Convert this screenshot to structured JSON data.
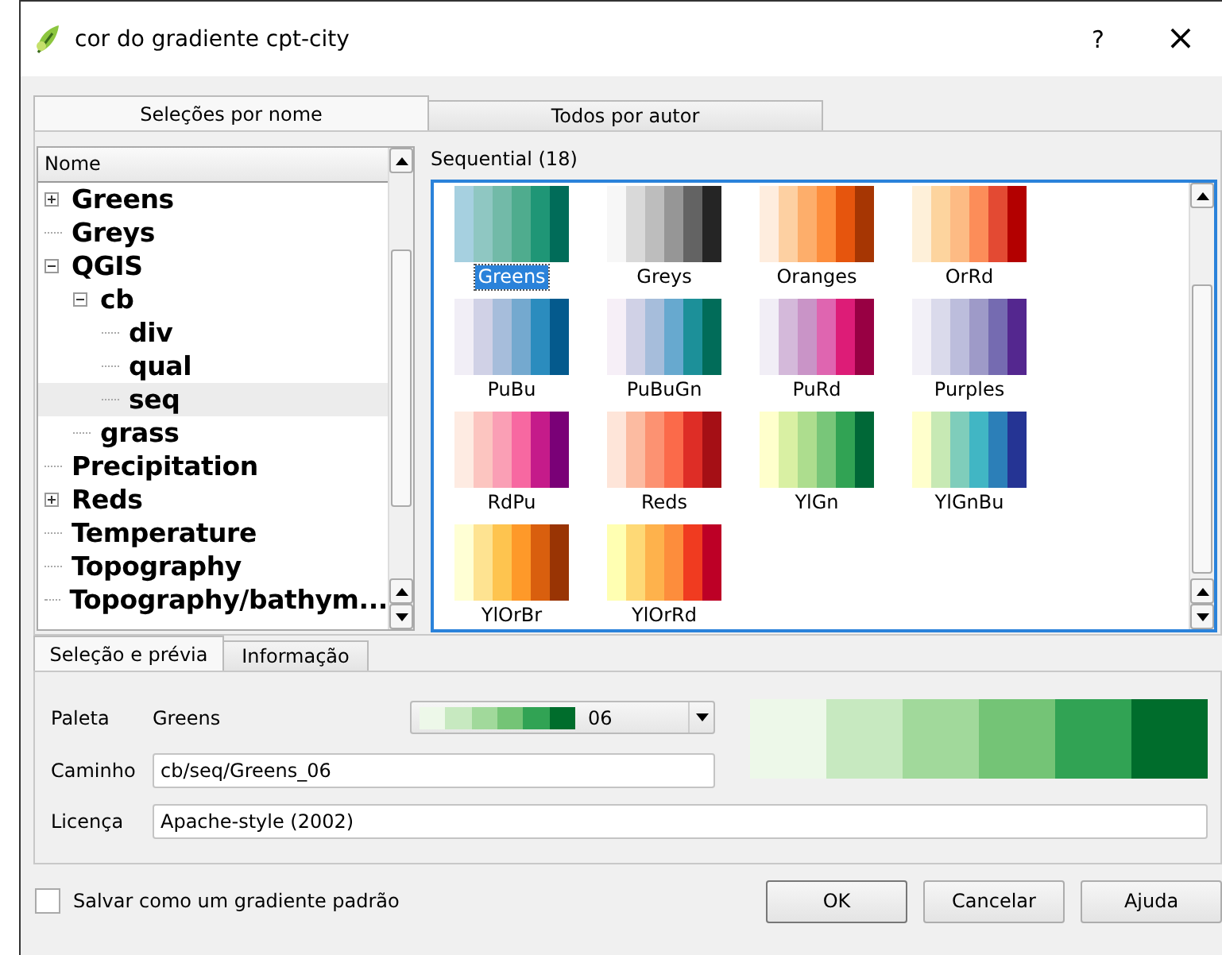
{
  "window": {
    "title": "cor do gradiente cpt-city",
    "help": "?",
    "close": "×"
  },
  "tabs": [
    {
      "label": "Seleções por nome",
      "selected": true
    },
    {
      "label": "Todos por autor",
      "selected": false
    }
  ],
  "tree": {
    "header": "Nome",
    "items": [
      {
        "label": "Greens",
        "expanded": false,
        "selected": false
      },
      {
        "label": "Greys",
        "selected": false
      },
      {
        "label": "QGIS",
        "expanded": true,
        "selected": false,
        "children": [
          {
            "label": "cb",
            "expanded": true,
            "selected": false,
            "children": [
              {
                "label": "div",
                "selected": false
              },
              {
                "label": "qual",
                "selected": false
              },
              {
                "label": "seq",
                "selected": true
              }
            ]
          },
          {
            "label": "grass",
            "selected": false
          }
        ]
      },
      {
        "label": "Precipitation",
        "selected": false
      },
      {
        "label": "Reds",
        "expanded": false,
        "selected": false
      },
      {
        "label": "Temperature",
        "selected": false
      },
      {
        "label": "Topography",
        "selected": false
      },
      {
        "label": "Topography/bathym...",
        "selected": false
      }
    ]
  },
  "gallery": {
    "title": "Sequential (18)",
    "palettes": [
      {
        "name": "Greens",
        "selected": true,
        "colors": [
          {
            "color": "#a6d0e0"
          },
          {
            "color": "#8fc7c2"
          },
          {
            "color": "#72baa8"
          },
          {
            "color": "#4fac8e"
          },
          {
            "color": "#1f9676"
          },
          {
            "color": "#016c59"
          }
        ]
      },
      {
        "name": "Greys",
        "selected": false,
        "colors": [
          {
            "color": "#f7f7f7"
          },
          {
            "color": "#d9d9d9"
          },
          {
            "color": "#bdbdbd"
          },
          {
            "color": "#969696"
          },
          {
            "color": "#636363"
          },
          {
            "color": "#252525"
          }
        ]
      },
      {
        "name": "Oranges",
        "selected": false,
        "colors": [
          {
            "color": "#feedde"
          },
          {
            "color": "#fdd0a2"
          },
          {
            "color": "#fdae6b"
          },
          {
            "color": "#fd8d3c"
          },
          {
            "color": "#e6550d"
          },
          {
            "color": "#a63603"
          }
        ]
      },
      {
        "name": "OrRd",
        "selected": false,
        "colors": [
          {
            "color": "#fef0d9"
          },
          {
            "color": "#fdd49e"
          },
          {
            "color": "#fdbb84"
          },
          {
            "color": "#fc8d59"
          },
          {
            "color": "#e34a33"
          },
          {
            "color": "#b30000"
          }
        ]
      },
      {
        "name": "PuBu",
        "selected": false,
        "colors": [
          {
            "color": "#f1eef6"
          },
          {
            "color": "#d0d1e6"
          },
          {
            "color": "#a6bddb"
          },
          {
            "color": "#74a9cf"
          },
          {
            "color": "#2b8cbe"
          },
          {
            "color": "#045a8d"
          }
        ]
      },
      {
        "name": "PuBuGn",
        "selected": false,
        "colors": [
          {
            "color": "#f6eff7"
          },
          {
            "color": "#d0d1e6"
          },
          {
            "color": "#a6bddb"
          },
          {
            "color": "#67a9cf"
          },
          {
            "color": "#1c9099"
          },
          {
            "color": "#016c59"
          }
        ]
      },
      {
        "name": "PuRd",
        "selected": false,
        "colors": [
          {
            "color": "#f1eef6"
          },
          {
            "color": "#d4b9da"
          },
          {
            "color": "#c994c7"
          },
          {
            "color": "#df65b0"
          },
          {
            "color": "#dd1c77"
          },
          {
            "color": "#980043"
          }
        ]
      },
      {
        "name": "Purples",
        "selected": false,
        "colors": [
          {
            "color": "#f2f0f7"
          },
          {
            "color": "#dadaeb"
          },
          {
            "color": "#bcbddc"
          },
          {
            "color": "#9e9ac8"
          },
          {
            "color": "#756bb1"
          },
          {
            "color": "#54278f"
          }
        ]
      },
      {
        "name": "RdPu",
        "selected": false,
        "colors": [
          {
            "color": "#feebe2"
          },
          {
            "color": "#fcc5c0"
          },
          {
            "color": "#fa9fb5"
          },
          {
            "color": "#f768a1"
          },
          {
            "color": "#c51b8a"
          },
          {
            "color": "#7a0177"
          }
        ]
      },
      {
        "name": "Reds",
        "selected": false,
        "colors": [
          {
            "color": "#fee5d9"
          },
          {
            "color": "#fcbba1"
          },
          {
            "color": "#fc9272"
          },
          {
            "color": "#fb6a4a"
          },
          {
            "color": "#de2d26"
          },
          {
            "color": "#a50f15"
          }
        ]
      },
      {
        "name": "YlGn",
        "selected": false,
        "colors": [
          {
            "color": "#ffffcc"
          },
          {
            "color": "#d9f0a3"
          },
          {
            "color": "#addd8e"
          },
          {
            "color": "#78c679"
          },
          {
            "color": "#31a354"
          },
          {
            "color": "#006837"
          }
        ]
      },
      {
        "name": "YlGnBu",
        "selected": false,
        "colors": [
          {
            "color": "#ffffcc"
          },
          {
            "color": "#c7e9b4"
          },
          {
            "color": "#7fcdbb"
          },
          {
            "color": "#41b6c4"
          },
          {
            "color": "#2c7fb8"
          },
          {
            "color": "#253494"
          }
        ]
      },
      {
        "name": "YlOrBr",
        "selected": false,
        "colors": [
          {
            "color": "#ffffd4"
          },
          {
            "color": "#fee391"
          },
          {
            "color": "#fec44f"
          },
          {
            "color": "#fe9929"
          },
          {
            "color": "#d95f0e"
          },
          {
            "color": "#993404"
          }
        ]
      },
      {
        "name": "YlOrRd",
        "selected": false,
        "colors": [
          {
            "color": "#ffffb2"
          },
          {
            "color": "#fed976"
          },
          {
            "color": "#feb24c"
          },
          {
            "color": "#fd8d3c"
          },
          {
            "color": "#f03b20"
          },
          {
            "color": "#bd0026"
          }
        ]
      }
    ]
  },
  "detail_tabs": [
    {
      "label": "Seleção e prévia",
      "selected": true
    },
    {
      "label": "Informação",
      "selected": false
    }
  ],
  "detail": {
    "palette_label": "Paleta",
    "palette_name": "Greens",
    "variant": "06",
    "variant_colors": [
      {
        "color": "#edf8e9"
      },
      {
        "color": "#c7e9c0"
      },
      {
        "color": "#a1d99b"
      },
      {
        "color": "#74c476"
      },
      {
        "color": "#31a354"
      },
      {
        "color": "#006d2c"
      }
    ],
    "path_label": "Caminho",
    "path": "cb/seq/Greens_06",
    "license_label": "Licença",
    "license": "Apache-style (2002)"
  },
  "default_checkbox": {
    "label": "Salvar como um gradiente padrão",
    "checked": false
  },
  "buttons": [
    "OK",
    "Cancelar",
    "Ajuda"
  ]
}
